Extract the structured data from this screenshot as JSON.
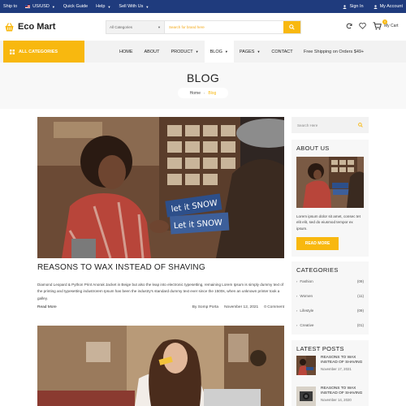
{
  "topbar": {
    "ship_to": "Ship to",
    "currency": "US/USD",
    "quick_guide": "Quick Guide",
    "help": "Help",
    "sell_with_us": "Sell With Us",
    "sign_in": "Sign In",
    "my_account": "My Account"
  },
  "header": {
    "logo_text": "Eco Mart",
    "category_select": "All Categories",
    "search_placeholder": "Search for brand here",
    "cart_label": "My Cart",
    "cart_count": "0"
  },
  "nav": {
    "all_categories": "ALL CATEGORIES",
    "items": [
      {
        "label": "HOME"
      },
      {
        "label": "ABOUT"
      },
      {
        "label": "PRODUCT"
      },
      {
        "label": "BLOG"
      },
      {
        "label": "PAGES"
      },
      {
        "label": "CONTACT"
      }
    ],
    "free_shipping": "Free Shipping on Orders $49+"
  },
  "banner": {
    "title": "BLOG",
    "crumb_home": "Home",
    "crumb_current": "Blog"
  },
  "post": {
    "title": "REASONS TO WAX INSTEAD OF SHAVING",
    "excerpt": "Diamond Leopard & Python Print Anorak Jacket in Beige but also the leap into electronic typesetting, remaining Lorem Ipsum is simply dummy text of the printing and typesetting industrorem Ipsum has been the industry's standard dummy text ever since the 1500s, when an unknown printer took a galley.",
    "read_more": "Read More",
    "author": "By Somp Porta",
    "date": "November 12, 2021",
    "comments": "0 Comment"
  },
  "sidebar": {
    "search_placeholder": "Search Here",
    "about": {
      "heading": "ABOUT US",
      "text": "Lorem ipsum dolor sit amet, consec tet elit elit, sed do eiusmod tempor ex ipsum.",
      "button": "READ MORE"
    },
    "categories": {
      "heading": "CATEGORIES",
      "items": [
        {
          "name": "Fashion",
          "count": "(09)"
        },
        {
          "name": "Women",
          "count": "(11)"
        },
        {
          "name": "Lifestyle",
          "count": "(09)"
        },
        {
          "name": "Creative",
          "count": "(01)"
        }
      ]
    },
    "latest": {
      "heading": "LATEST POSTS",
      "items": [
        {
          "title": "REASONS TO WAX INSTEAD OF SHAVING",
          "date": "November 17, 2021"
        },
        {
          "title": "REASONS TO WAX INSTEAD OF SHAVING",
          "date": "November 14, 2020"
        }
      ]
    }
  },
  "colors": {
    "topbar": "#1f3b7d",
    "accent": "#f8b80f"
  }
}
